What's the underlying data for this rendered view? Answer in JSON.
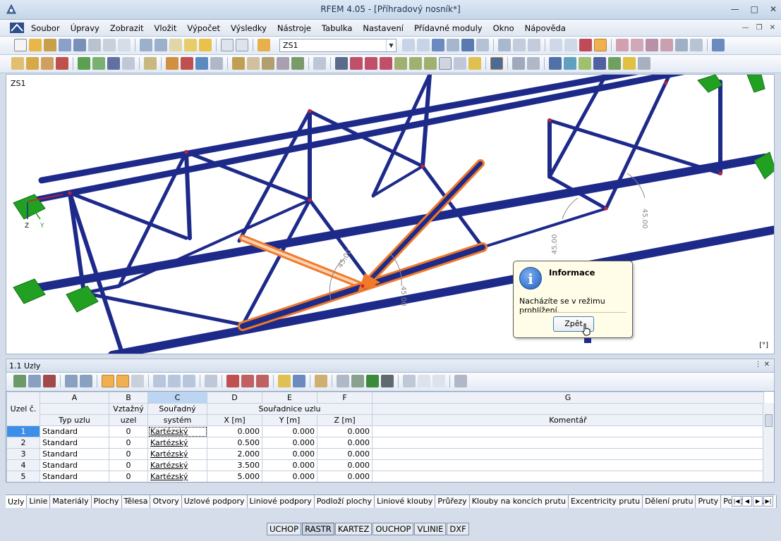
{
  "window": {
    "app_name": "RFEM 4.05",
    "separator": " - ",
    "document": "[Příhradový nosník*]"
  },
  "menu": [
    "Soubor",
    "Úpravy",
    "Zobrazit",
    "Vložit",
    "Výpočet",
    "Výsledky",
    "Nástroje",
    "Tabulka",
    "Nastavení",
    "Přídavné moduly",
    "Okno",
    "Nápověda"
  ],
  "toolbar": {
    "load_case": "ZS1"
  },
  "viewport": {
    "label": "ZS1",
    "unit": "[°]",
    "axis_z": "Z",
    "axis_y": "Y",
    "angle_labels": [
      "45.00",
      "45.00",
      "45.00",
      "45.00"
    ]
  },
  "info_popup": {
    "icon": "info-icon",
    "title": "Informace",
    "message": "Nacházíte se v režimu prohlížení.",
    "button": "Zpět"
  },
  "panel": {
    "title": "1.1 Uzly"
  },
  "table": {
    "col_letters": [
      "A",
      "B",
      "C",
      "D",
      "E",
      "F",
      "G"
    ],
    "row_header_label": "Uzel č.",
    "group_header": "Souřadnice uzlu",
    "headers_top": [
      "",
      "Vztažný",
      "Souřadný",
      "",
      "",
      "",
      ""
    ],
    "headers_bottom": [
      "Typ uzlu",
      "uzel",
      "systém",
      "X [m]",
      "Y [m]",
      "Z [m]",
      "Komentář"
    ],
    "rows": [
      {
        "no": "1",
        "type": "Standard",
        "ref": "0",
        "cs": "Kartézský",
        "x": "0.000",
        "y": "0.000",
        "z": "0.000",
        "comment": ""
      },
      {
        "no": "2",
        "type": "Standard",
        "ref": "0",
        "cs": "Kartézský",
        "x": "0.500",
        "y": "0.000",
        "z": "0.000",
        "comment": ""
      },
      {
        "no": "3",
        "type": "Standard",
        "ref": "0",
        "cs": "Kartézský",
        "x": "2.000",
        "y": "0.000",
        "z": "0.000",
        "comment": ""
      },
      {
        "no": "4",
        "type": "Standard",
        "ref": "0",
        "cs": "Kartézský",
        "x": "3.500",
        "y": "0.000",
        "z": "0.000",
        "comment": ""
      },
      {
        "no": "5",
        "type": "Standard",
        "ref": "0",
        "cs": "Kartézský",
        "x": "5.000",
        "y": "0.000",
        "z": "0.000",
        "comment": ""
      }
    ]
  },
  "sheet_tabs": [
    "Uzly",
    "Linie",
    "Materiály",
    "Plochy",
    "Tělesa",
    "Otvory",
    "Uzlové podpory",
    "Liniové podpory",
    "Podloží plochy",
    "Liniové klouby",
    "Průřezy",
    "Klouby na koncích prutu",
    "Excentricity prutu",
    "Dělení prutu",
    "Pruty",
    "Podloží prutu"
  ],
  "status_buttons": [
    "UCHOP",
    "RASTR",
    "KARTEZ",
    "OUCHOP",
    "VLINIE",
    "DXF"
  ],
  "colors": {
    "member": "#1d2a8a",
    "support": "#22a022",
    "highlight": "#f07a2a",
    "node": "#d0202a"
  }
}
